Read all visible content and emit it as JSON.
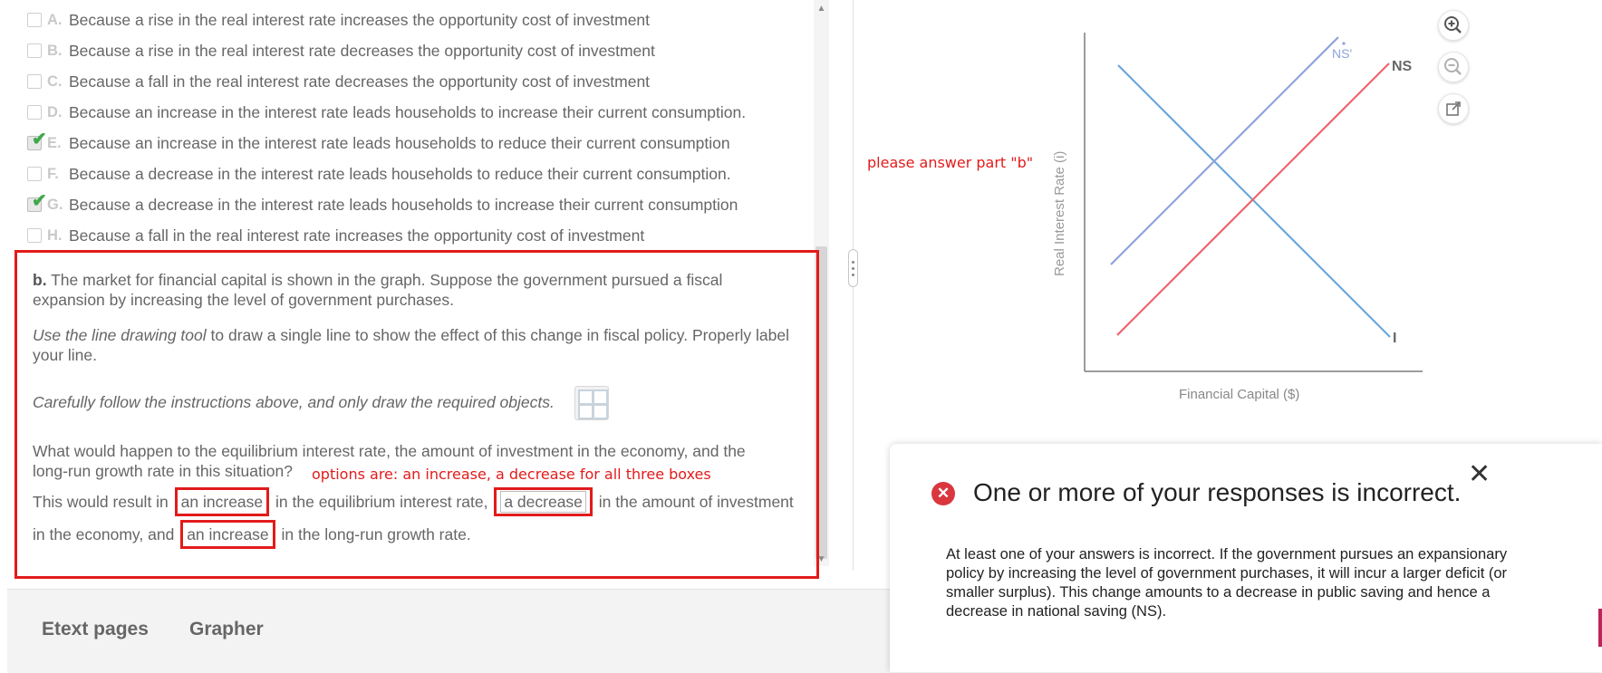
{
  "choices": [
    {
      "letter": "A.",
      "text": "Because a rise in the real interest rate increases the opportunity cost of investment",
      "checked": false
    },
    {
      "letter": "B.",
      "text": "Because a rise in the real interest rate decreases the opportunity cost of investment",
      "checked": false
    },
    {
      "letter": "C.",
      "text": "Because a fall in the real interest rate decreases the opportunity cost of investment",
      "checked": false
    },
    {
      "letter": "D.",
      "text": "Because an increase in the interest rate leads households to increase their current consumption.",
      "checked": false
    },
    {
      "letter": "E.",
      "text": "Because an increase in the interest rate leads households to reduce their current consumption",
      "checked": true
    },
    {
      "letter": "F.",
      "text": "Because a decrease in the interest rate leads households to reduce their current consumption.",
      "checked": false
    },
    {
      "letter": "G.",
      "text": "Because a decrease in the interest rate leads households to increase their current consumption",
      "checked": true
    },
    {
      "letter": "H.",
      "text": "Because a fall in the real interest rate increases the opportunity cost of investment",
      "checked": false
    }
  ],
  "part_b": {
    "label": "b.",
    "intro": "The market for financial capital is shown in the graph. Suppose the government pursued a fiscal expansion by increasing the level of government purchases.",
    "instruction_italic": "Use the line drawing tool",
    "instruction_rest": "to draw a single line to show the effect of this change in fiscal policy. Properly label your line.",
    "careful": "Carefully follow the instructions above, and only draw the required objects.",
    "question": "What would happen to the equilibrium interest rate, the amount of investment in the economy, and the long-run growth rate in this situation?",
    "sentence_1": "This would result in",
    "sentence_2": "in the equilibrium interest rate,",
    "sentence_3": "in the amount of investment",
    "sentence_4": "in the economy, and",
    "sentence_5": "in the long-run growth rate.",
    "answers": [
      "an increase",
      "a decrease",
      "an increase"
    ]
  },
  "annotations": {
    "please": "please answer part \"b\"",
    "options": "options are: an increase, a decrease  for all three boxes"
  },
  "bottom_tabs": [
    "Etext pages",
    "Grapher"
  ],
  "graph": {
    "y_label": "Real Interest Rate (i)",
    "x_label": "Financial Capital ($)",
    "lines": {
      "ns": "NS",
      "ns_prime": "NS'",
      "investment": "I"
    }
  },
  "feedback": {
    "title": "One or more of your responses is incorrect.",
    "body": "At least one of your answers is incorrect. If the government pursues an expansionary policy by increasing the level of government purchases, it will incur a larger deficit (or smaller surplus). This change amounts to a decrease in public saving and hence a decrease in national saving (NS)."
  },
  "colors": {
    "annotation_red": "#e21b1b",
    "ns_line": "#f0636b",
    "ns_prime_line": "#8ea3dc",
    "i_line": "#6aa7dd"
  }
}
